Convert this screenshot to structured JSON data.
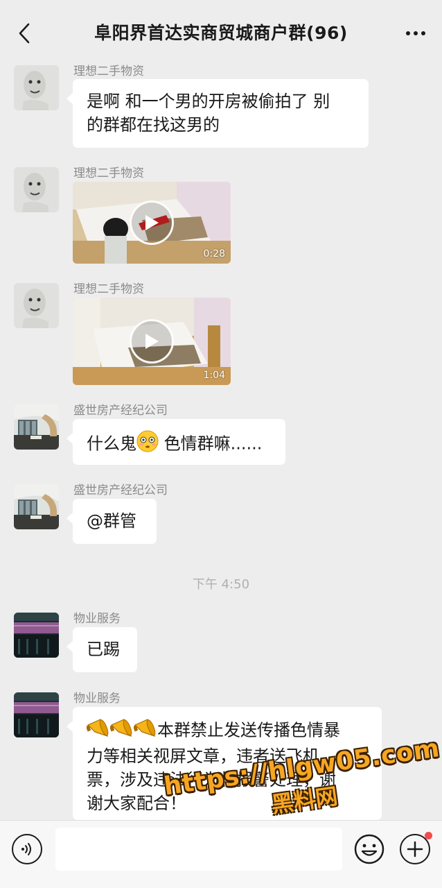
{
  "header": {
    "title": "阜阳界首达实商贸城商户群(96)"
  },
  "messages": [
    {
      "sender": "理想二手物资",
      "text_line1": "是啊 和一个男的开房被偷拍了 别",
      "text_line2": "的群都在找这男的"
    },
    {
      "sender": "理想二手物资",
      "video_duration": "0:28"
    },
    {
      "sender": "理想二手物资",
      "video_duration": "1:04"
    },
    {
      "sender": "盛世房产经纪公司",
      "text_before": "什么鬼",
      "emoji": "flushed-face-emoji",
      "text_after": " 色情群嘛......"
    },
    {
      "sender": "盛世房产经纪公司",
      "text": "@群管"
    },
    {
      "sender": "物业服务",
      "text": "已踢"
    },
    {
      "sender": "物业服务",
      "emojis": "megaphone-emoji",
      "text_line1": "本群禁止发送传播色情暴",
      "text_line2": "力等相关视屏文章，违者送飞机",
      "text_line3": "票，涉及违法行为将报警处理，谢",
      "text_line4": "谢大家配合！"
    }
  ],
  "time_divider": "下午 4:50",
  "watermark": {
    "line1": "https://hlgw05.com",
    "line2": "黑料网"
  },
  "colors": {
    "background": "#ededed",
    "bubble": "#ffffff",
    "sender": "#8a8a8a",
    "badge": "#f04d4d"
  }
}
